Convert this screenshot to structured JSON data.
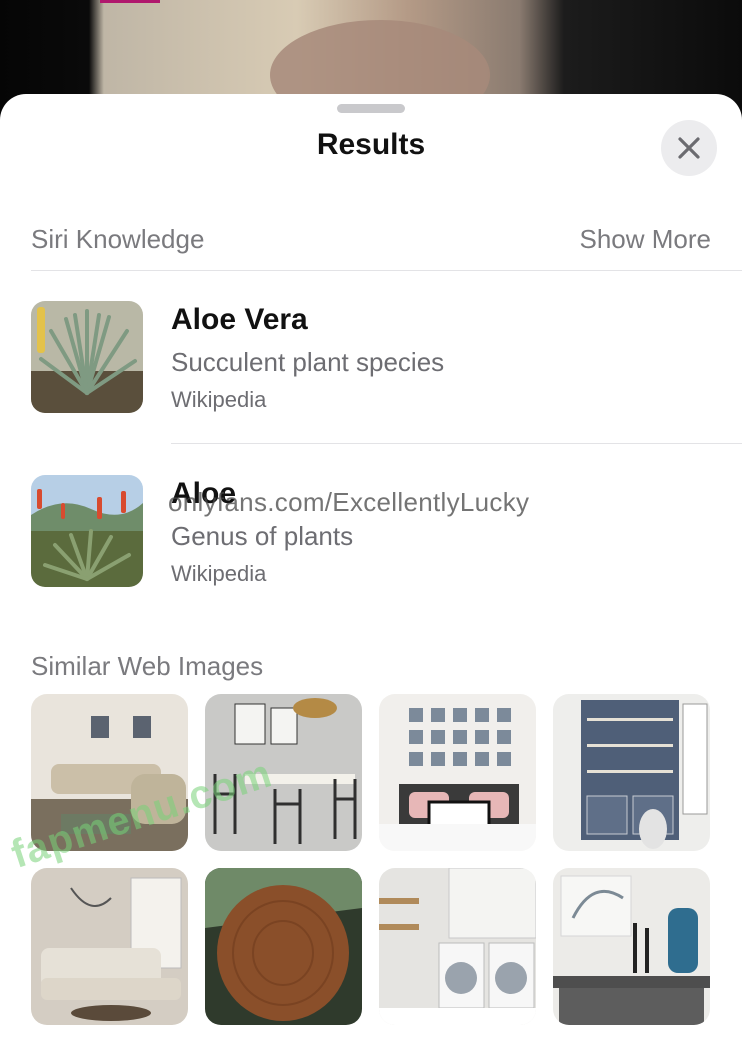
{
  "header": {
    "title": "Results"
  },
  "siri_knowledge": {
    "heading": "Siri Knowledge",
    "show_more": "Show More",
    "results": [
      {
        "name": "Aloe Vera",
        "description": "Succulent plant species",
        "source": "Wikipedia",
        "image": "aloe-vera-photo"
      },
      {
        "name": "Aloe",
        "description": "Genus of plants",
        "source": "Wikipedia",
        "image": "aloe-genus-photo"
      }
    ]
  },
  "similar_images": {
    "heading": "Similar Web Images",
    "items": [
      "living-room-sectional-photo",
      "dining-room-photo",
      "bedroom-gallery-wall-photo",
      "blue-built-in-shelves-photo",
      "white-sofa-living-room-photo",
      "wood-slab-photo",
      "laundry-room-photo",
      "console-table-decor-photo"
    ]
  },
  "overlays": {
    "watermark_url": "onlyfans.com/ExcellentlyLucky",
    "watermark_site": "fapmenu.com"
  },
  "colors": {
    "sheet": "#ffffff",
    "secondary_text": "#6d6d72",
    "primary_text": "#111111"
  }
}
